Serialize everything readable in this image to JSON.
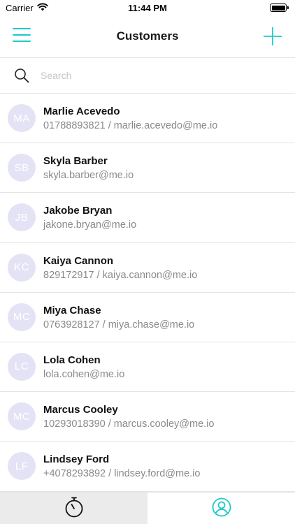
{
  "status_bar": {
    "carrier": "Carrier",
    "time": "11:44 PM",
    "battery_level": 1.0
  },
  "header": {
    "title": "Customers",
    "menu_icon": "hamburger-menu-icon",
    "add_icon": "plus-icon"
  },
  "search": {
    "placeholder": "Search",
    "value": "",
    "icon": "magnifier-icon"
  },
  "customers": [
    {
      "initials": "MA",
      "name": "Marlie Acevedo",
      "detail": "01788893821 / marlie.acevedo@me.io"
    },
    {
      "initials": "SB",
      "name": "Skyla Barber",
      "detail": "skyla.barber@me.io"
    },
    {
      "initials": "JB",
      "name": "Jakobe Bryan",
      "detail": "jakone.bryan@me.io"
    },
    {
      "initials": "KC",
      "name": "Kaiya Cannon",
      "detail": "829172917 / kaiya.cannon@me.io"
    },
    {
      "initials": "MC",
      "name": "Miya Chase",
      "detail": "0763928127 / miya.chase@me.io"
    },
    {
      "initials": "LC",
      "name": "Lola Cohen",
      "detail": "lola.cohen@me.io"
    },
    {
      "initials": "MC",
      "name": "Marcus Cooley",
      "detail": "10293018390 / marcus.cooley@me.io"
    },
    {
      "initials": "LF",
      "name": "Lindsey Ford",
      "detail": "+4078293892 / lindsey.ford@me.io"
    }
  ],
  "tab_bar": {
    "tabs": [
      {
        "icon": "stopwatch-icon",
        "selected": false
      },
      {
        "icon": "user-circle-icon",
        "selected": true
      }
    ]
  },
  "colors": {
    "accent": "#1fc8c8",
    "avatar_bg": "#e4e3f6",
    "secondary_text": "#8a8a8a",
    "divider": "#e4e4e4",
    "tab_inactive_bg": "#ebebeb"
  }
}
